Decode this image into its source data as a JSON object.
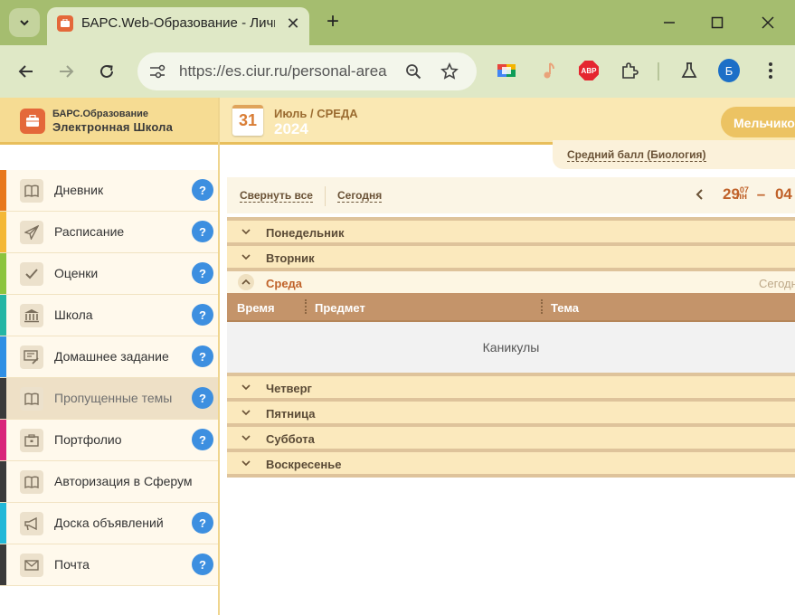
{
  "browser": {
    "tab_title": "БАРС.Web-Образование - Личный кабинет",
    "new_tab_symbol": "+",
    "url": "https://es.ciur.ru/personal-area",
    "profile_letter": "Б",
    "abp_label": "ABP",
    "theme_color": "#a5bd6f"
  },
  "header": {
    "brand_small": "БАРС.Образование",
    "brand_big": "Электронная Школа",
    "calendar_day": "31",
    "date_text": "Июль / СРЕДА",
    "year": "2024",
    "user_name": "Мельчиков",
    "average_link": "Средний балл (Биология)"
  },
  "sidebar": {
    "items": [
      {
        "label": "Дневник",
        "icon": "book-icon",
        "color": "#e8781c"
      },
      {
        "label": "Расписание",
        "icon": "paper-plane-icon",
        "color": "#f4b836"
      },
      {
        "label": "Оценки",
        "icon": "checkmark-icon",
        "color": "#8cc43e"
      },
      {
        "label": "Школа",
        "icon": "building-icon",
        "color": "#24b5a4"
      },
      {
        "label": "Домашнее задание",
        "icon": "homework-icon",
        "color": "#2f8fe4"
      },
      {
        "label": "Пропущенные темы",
        "icon": "book-icon",
        "color": "#3a3a3a"
      },
      {
        "label": "Портфолио",
        "icon": "briefcase-icon",
        "color": "#d9247a"
      },
      {
        "label": "Авторизация в Сферум",
        "icon": "book-icon",
        "color": "#3a3a3a"
      },
      {
        "label": "Доска объявлений",
        "icon": "megaphone-icon",
        "color": "#22b8d8"
      },
      {
        "label": "Почта",
        "icon": "envelope-icon",
        "color": "#3a3a3a"
      }
    ],
    "help_symbol": "?"
  },
  "controls": {
    "collapse_all": "Свернуть все",
    "today": "Сегодня",
    "week_start_day": "29",
    "week_start_month": "07",
    "week_start_weekday": "пн",
    "week_dash": "–",
    "week_end_day": "04"
  },
  "days": {
    "monday": "Понедельник",
    "tuesday": "Вторник",
    "wednesday": "Среда",
    "today_tag": "Сегодня",
    "thursday": "Четверг",
    "friday": "Пятница",
    "saturday": "Суббота",
    "sunday": "Воскресенье"
  },
  "table": {
    "col_time": "Время",
    "col_subject": "Предмет",
    "col_topic": "Тема",
    "holiday_text": "Каникулы"
  }
}
